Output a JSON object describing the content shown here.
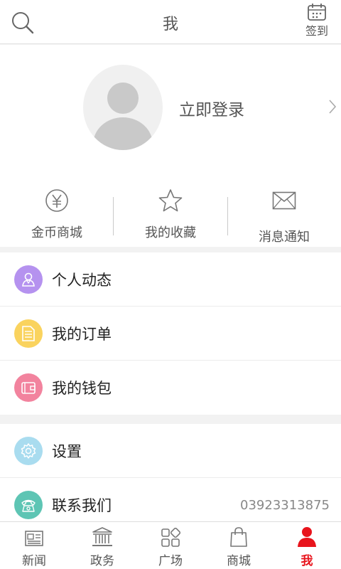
{
  "header": {
    "title": "我",
    "signin_label": "签到"
  },
  "profile": {
    "login_text": "立即登录"
  },
  "quick_actions": [
    {
      "label": "金币商城",
      "icon": "yen-coin-icon"
    },
    {
      "label": "我的收藏",
      "icon": "star-icon"
    },
    {
      "label": "消息通知",
      "icon": "envelope-icon"
    }
  ],
  "menu_group_1": [
    {
      "label": "个人动态",
      "icon": "person-icon",
      "color": "#b592ef"
    },
    {
      "label": "我的订单",
      "icon": "document-icon",
      "color": "#fad35e"
    },
    {
      "label": "我的钱包",
      "icon": "wallet-icon",
      "color": "#f2839e"
    }
  ],
  "menu_group_2": [
    {
      "label": "设置",
      "icon": "gear-icon",
      "color": "#a9dcef"
    },
    {
      "label": "联系我们",
      "icon": "phone-icon",
      "color": "#5ec5b4",
      "value": "03923313875"
    }
  ],
  "bottom_nav": [
    {
      "label": "新闻",
      "icon": "newspaper-icon",
      "active": false
    },
    {
      "label": "政务",
      "icon": "government-building-icon",
      "active": false
    },
    {
      "label": "广场",
      "icon": "grid-apps-icon",
      "active": false
    },
    {
      "label": "商城",
      "icon": "shopping-bag-icon",
      "active": false
    },
    {
      "label": "我",
      "icon": "user-icon",
      "active": true
    }
  ],
  "colors": {
    "accent": "#e8141c",
    "background": "#f2f2f2"
  }
}
